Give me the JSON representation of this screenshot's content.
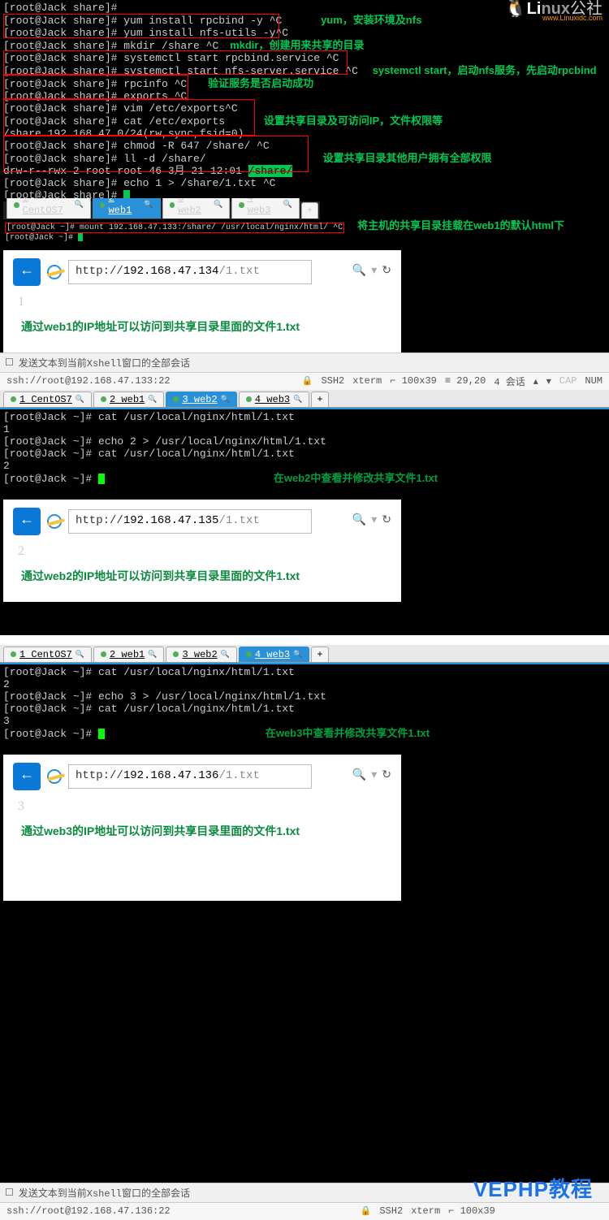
{
  "logo": {
    "title": "Linux",
    "sub": "www.Linuxidc.com"
  },
  "top_term": {
    "l0": "[root@Jack share]#",
    "l1": "[root@Jack share]# yum install rpcbind -y ^C",
    "l2": "[root@Jack share]# yum install nfs-utils  -y^C",
    "ann1": "yum，安装环境及nfs",
    "l3": "[root@Jack share]# mkdir /share ^C",
    "ann2": "mkdir，创建用来共享的目录",
    "l4": "[root@Jack share]# systemctl start rpcbind.service ^C",
    "l5": "[root@Jack share]# systemctl start nfs-server.service ^C",
    "ann3": "systemctl start，启动nfs服务，先启动rpcbind",
    "l6": "[root@Jack share]# rpcinfo ^C",
    "l7": "[root@Jack share]# exports  ^C",
    "ann4": "验证服务是否启动成功",
    "l8": "[root@Jack share]# vim /etc/exports^C",
    "l9": "[root@Jack share]# cat /etc/exports",
    "l10": "/share 192.168.47.0/24(rw,sync,fsid=0)",
    "ann5": "设置共享目录及可访问IP，文件权限等",
    "l11": "[root@Jack share]# chmod -R 647 /share/ ^C",
    "l12": "[root@Jack share]# ll -d /share/",
    "l13a": "drw-r--rwx 2 root root 46 3月  21 12:01 ",
    "l13b": "/share/",
    "ann6": "设置共享目录其他用户拥有全部权限",
    "l14": "[root@Jack share]# echo 1 > /share/1.txt ^C",
    "l15": "[root@Jack share]# "
  },
  "web1": {
    "tabs": [
      "1 CentOS7",
      "2 web1",
      "3 web2",
      "4 web3"
    ],
    "mount": "[root@Jack ~]# mount 192.168.47.133:/share/ /usr/local/nginx/html/ ^C",
    "prompt": "[root@Jack ~]# ",
    "ann": "将主机的共享目录挂载在web1的默认html下",
    "url_host": "192.168.47.134",
    "url_path": "/1.txt",
    "content": "1",
    "note": "通过web1的IP地址可以访问到共享目录里面的文件1.txt"
  },
  "bar133": {
    "send": "发送文本到当前Xshell窗口的全部会话",
    "ssh": "ssh://root@192.168.47.133:22",
    "proto": "SSH2",
    "termtype": "xterm",
    "size": "100x39",
    "pos": "29,20",
    "sess": "4 会话",
    "cap": "CAP",
    "num": "NUM"
  },
  "web2": {
    "tabs": [
      "1 CentOS7",
      "2 web1",
      "3 web2",
      "4 web3"
    ],
    "l1": "[root@Jack ~]# cat /usr/local/nginx/html/1.txt",
    "l2": "1",
    "l3": "[root@Jack ~]# echo 2 > /usr/local/nginx/html/1.txt",
    "l4": "[root@Jack ~]# cat /usr/local/nginx/html/1.txt",
    "l5": "2",
    "l6": "[root@Jack ~]# ",
    "ann": "在web2中查看并修改共享文件1.txt",
    "url_host": "192.168.47.135",
    "url_path": "/1.txt",
    "content": "2",
    "note": "通过web2的IP地址可以访问到共享目录里面的文件1.txt"
  },
  "web3": {
    "tabs": [
      "1 CentOS7",
      "2 web1",
      "3 web2",
      "4 web3"
    ],
    "l1": "[root@Jack ~]# cat /usr/local/nginx/html/1.txt",
    "l2": "2",
    "l3": "[root@Jack ~]# echo 3 > /usr/local/nginx/html/1.txt",
    "l4": "[root@Jack ~]# cat /usr/local/nginx/html/1.txt",
    "l5": "3",
    "l6": "[root@Jack ~]# ",
    "ann": "在web3中查看并修改共享文件1.txt",
    "url_host": "192.168.47.136",
    "url_path": "/1.txt",
    "content": "3",
    "note": "通过web3的IP地址可以访问到共享目录里面的文件1.txt"
  },
  "bar136": {
    "send": "发送文本到当前Xshell窗口的全部会话",
    "ssh": "ssh://root@192.168.47.136:22",
    "proto": "SSH2",
    "termtype": "xterm",
    "size": "100x39"
  },
  "watermark": "VEPHP教程",
  "icons": {
    "lock": "🔒",
    "mag": "🔍",
    "search": "🔍",
    "refresh": "↻",
    "down": "▾",
    "up": "▴",
    "plus": "+",
    "arrow_left": "←",
    "box": "☐"
  }
}
